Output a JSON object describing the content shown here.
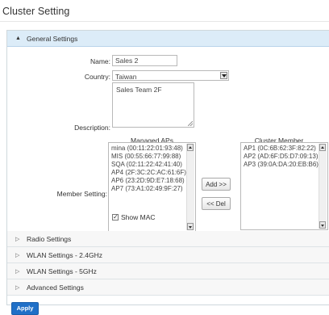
{
  "page": {
    "title": "Cluster Setting"
  },
  "general": {
    "header": "General Settings",
    "name_label": "Name:",
    "name_value": "Sales 2",
    "country_label": "Country:",
    "country_value": "Taiwan",
    "description_label": "Description:",
    "description_value": "Sales Team 2F",
    "member_label": "Member Setting:",
    "managed_title": "Managed APs",
    "managed_aps": [
      "mina (00:11:22:01:93:48)",
      "MIS (00:55:66:77:99:88)",
      "SQA (02:11:22:42:41:40)",
      "AP4 (2F:3C:2C:AC:61:6F)",
      "AP6 (23:2D:9D:E7:18:68)",
      "AP7 (73:A1:02:49:9F:27)"
    ],
    "member_title": "Cluster Member",
    "cluster_members": [
      "AP1 (0C:6B:62:3F:82:22)",
      "AP2 (AD:6F:D5:D7:09:13)",
      "AP3 (39:0A:DA:20:EB:B6)"
    ],
    "add_button": "Add >>",
    "del_button": "<< Del",
    "show_mac_label": "Show MAC",
    "show_mac_checked": true
  },
  "sections": [
    {
      "label": "Radio Settings"
    },
    {
      "label": "WLAN Settings - 2.4GHz"
    },
    {
      "label": "WLAN Settings - 5GHz"
    },
    {
      "label": "Advanced Settings"
    }
  ],
  "apply_label": "Apply"
}
